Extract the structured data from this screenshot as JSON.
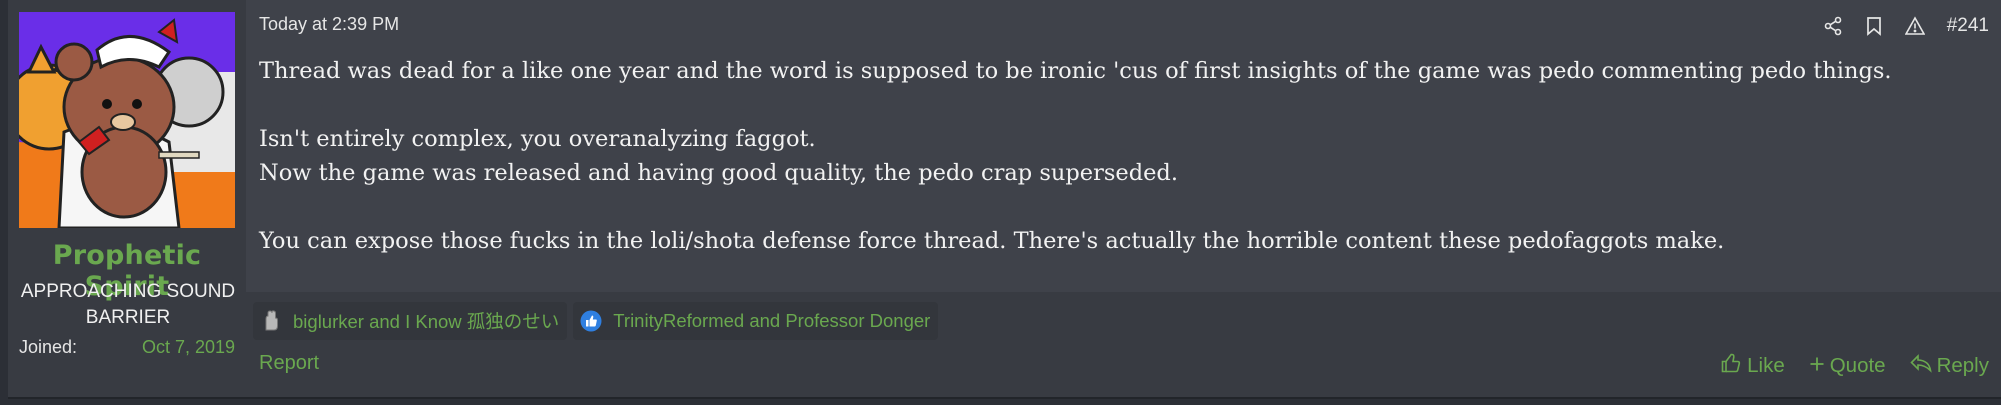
{
  "user": {
    "name": "Prophetic Spirit",
    "title": "APPROACHING SOUND BARRIER",
    "joined_label": "Joined:",
    "joined_value": "Oct 7, 2019"
  },
  "post": {
    "timestamp": "Today at 2:39 PM",
    "number": "#241",
    "paragraphs": [
      "Thread was dead for a like one year and the word is supposed to be ironic 'cus of first insights of the game was pedo commenting pedo things.",
      "",
      "Isn't entirely complex, you overanalyzing faggot.",
      "Now the game was released and having good quality, the pedo crap superseded.",
      "",
      "You can expose those fucks in the loli/shota defense force thread. There's actually the horrible content these pedofaggots make."
    ]
  },
  "reactions": [
    {
      "icon": "gray-hand-icon",
      "text": "biglurker and I Know 孤独のせい"
    },
    {
      "icon": "like-icon",
      "text": "TrinityReformed and Professor Donger"
    }
  ],
  "actions": {
    "report": "Report",
    "like": "Like",
    "quote": "Quote",
    "reply": "Reply"
  },
  "colors": {
    "accent": "#6aa84f",
    "post_bg": "#3f424a",
    "user_bg": "#383b42",
    "like_blue": "#2f7fe0"
  }
}
